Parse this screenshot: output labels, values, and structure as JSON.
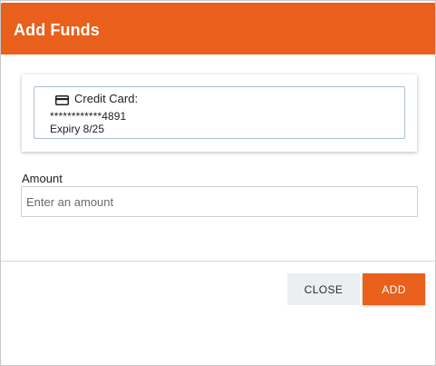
{
  "dialog": {
    "title": "Add Funds"
  },
  "payment_method": {
    "icon": "credit-card-icon",
    "label": "Credit Card:",
    "number": "************4891",
    "expiry": "Expiry 8/25"
  },
  "amount": {
    "label": "Amount",
    "placeholder": "Enter an amount",
    "value": ""
  },
  "actions": {
    "close_label": "CLOSE",
    "add_label": "ADD"
  },
  "colors": {
    "accent": "#e8601c",
    "secondary_button": "#eceff2",
    "card_border": "#aebfcc"
  }
}
